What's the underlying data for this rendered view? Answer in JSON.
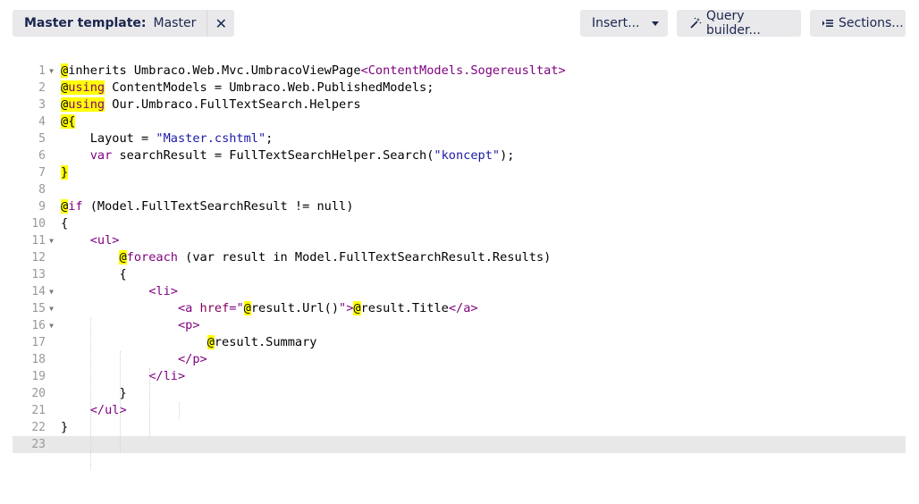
{
  "toolbar": {
    "master_label": "Master template:",
    "master_value": "Master",
    "close_glyph": "✕",
    "insert_label": "Insert...",
    "query_label": "Query builder...",
    "sections_label": "Sections..."
  },
  "editor": {
    "active_line": 23,
    "lines": [
      {
        "n": "1",
        "fold": true
      },
      {
        "n": "2",
        "fold": false
      },
      {
        "n": "3",
        "fold": false
      },
      {
        "n": "4",
        "fold": false
      },
      {
        "n": "5",
        "fold": false
      },
      {
        "n": "6",
        "fold": false
      },
      {
        "n": "7",
        "fold": false
      },
      {
        "n": "8",
        "fold": false
      },
      {
        "n": "9",
        "fold": false
      },
      {
        "n": "10",
        "fold": false
      },
      {
        "n": "11",
        "fold": true
      },
      {
        "n": "12",
        "fold": false
      },
      {
        "n": "13",
        "fold": false
      },
      {
        "n": "14",
        "fold": true
      },
      {
        "n": "15",
        "fold": true
      },
      {
        "n": "16",
        "fold": true
      },
      {
        "n": "17",
        "fold": false
      },
      {
        "n": "18",
        "fold": false
      },
      {
        "n": "19",
        "fold": false
      },
      {
        "n": "20",
        "fold": false
      },
      {
        "n": "21",
        "fold": false
      },
      {
        "n": "22",
        "fold": false
      },
      {
        "n": "23",
        "fold": false
      }
    ],
    "tokens": {
      "l1": [
        "@",
        "inherits Umbraco.Web.Mvc.UmbracoViewPage",
        "<ContentModels.Sogereusltat>"
      ],
      "l2": [
        "@",
        "using",
        " ContentModels = Umbraco.Web.PublishedModels;"
      ],
      "l3": [
        "@",
        "using",
        " Our.Umbraco.FullTextSearch.Helpers"
      ],
      "l4": [
        "@{"
      ],
      "l5": [
        "    Layout = ",
        "\"Master.cshtml\"",
        ";"
      ],
      "l6": [
        "    ",
        "var",
        " searchResult = FullTextSearchHelper.Search(",
        "\"koncept\"",
        ");"
      ],
      "l7": [
        "}"
      ],
      "l9": [
        "@",
        "if",
        " (Model.FullTextSearchResult != null)"
      ],
      "l10": [
        "{"
      ],
      "l11": [
        "    ",
        "<ul>"
      ],
      "l12": [
        "        ",
        "@",
        "foreach",
        " (var result in Model.FullTextSearchResult.Results)"
      ],
      "l13": [
        "        {"
      ],
      "l14": [
        "            ",
        "<li>"
      ],
      "l15": [
        "                ",
        "<a ",
        "href",
        "=\"",
        "@",
        "result.Url()",
        "\">",
        "@",
        "result.Title",
        "</a>"
      ],
      "l16": [
        "                ",
        "<p>"
      ],
      "l17": [
        "                    ",
        "@",
        "result.Summary"
      ],
      "l18": [
        "                ",
        "</p>"
      ],
      "l19": [
        "            ",
        "</li>"
      ],
      "l20": [
        "        }"
      ],
      "l21": [
        "    ",
        "</ul>"
      ],
      "l22": [
        "}"
      ]
    }
  }
}
